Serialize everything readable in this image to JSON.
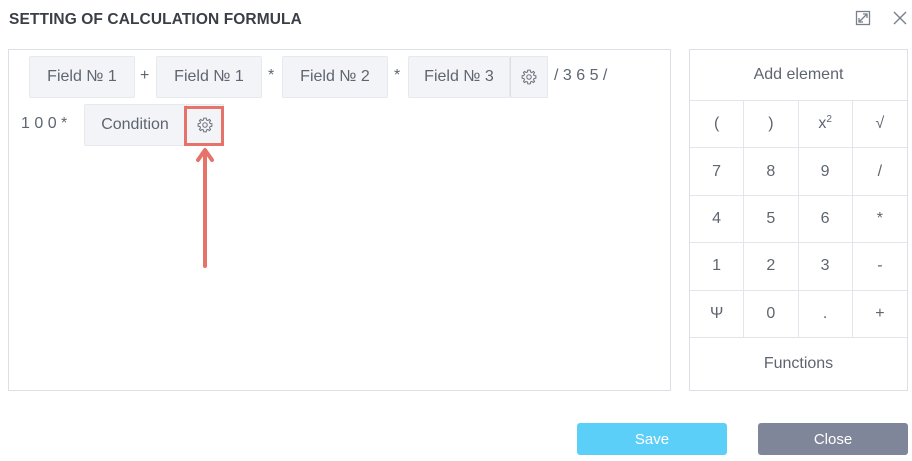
{
  "dialog": {
    "title": "SETTING OF CALCULATION FORMULA",
    "expand_icon": "expand-icon",
    "close_icon": "close-icon"
  },
  "formula": {
    "field1": "Field № 1",
    "op_plus": "+",
    "field2": "Field № 1",
    "op_mul1": "*",
    "field3": "Field № 2",
    "op_mul2": "*",
    "field4": "Field № 3",
    "tail1": "/ 3 6 5 /",
    "lead2": "1 0 0 *",
    "condition": "Condition",
    "settings_icon": "gear-icon"
  },
  "keypad": {
    "header": "Add element",
    "keys": [
      [
        "(",
        ")",
        "x2",
        "√"
      ],
      [
        "7",
        "8",
        "9",
        "/"
      ],
      [
        "4",
        "5",
        "6",
        "*"
      ],
      [
        "1",
        "2",
        "3",
        "-"
      ],
      [
        "Ψ",
        "0",
        ".",
        "+"
      ]
    ],
    "square_base": "x",
    "square_exp": "2",
    "footer": "Functions"
  },
  "buttons": {
    "save": "Save",
    "close": "Close"
  },
  "colors": {
    "save_bg": "#5ccff9",
    "close_bg": "#7f8699",
    "highlight": "#e5736a"
  }
}
